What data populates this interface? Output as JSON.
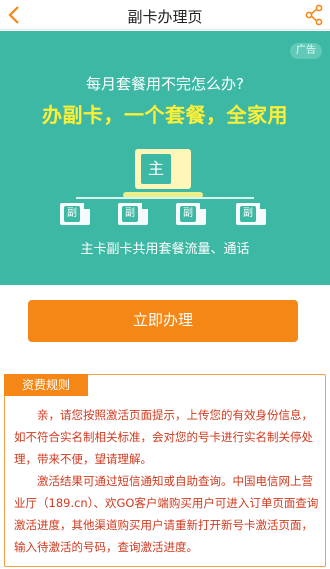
{
  "header": {
    "title": "副卡办理页",
    "back_icon": "chevron-left-icon",
    "share_icon": "share-icon",
    "accent": "#f48715"
  },
  "banner": {
    "ad_badge": "广告",
    "question": "每月套餐用不完怎么办?",
    "headline": "办副卡，一个套餐，全家用",
    "main_card_label": "主",
    "sub_card_label": "副",
    "caption": "主卡副卡共用套餐流量、通话",
    "colors": {
      "background": "#3cb8a4",
      "headline": "#ffef36"
    }
  },
  "action": {
    "apply_label": "立即办理"
  },
  "rules": {
    "tab_label": "资费规则",
    "paragraphs": [
      "亲，请您按照激活页面提示，上传您的有效身份信息，如不符合实名制相关标准，会对您的号卡进行实名制关停处理，带来不便，望请理解。",
      "激活结果可通过短信通知或自助查询。中国电信网上营业厅（189.cn）、欢GO客户端购买用户可进入订单页面查询激活进度，其他渠道购买用户请重新打开新号卡激活页面，输入待激活的号码，查询激活进度。"
    ],
    "text_color": "#d03a1e"
  }
}
